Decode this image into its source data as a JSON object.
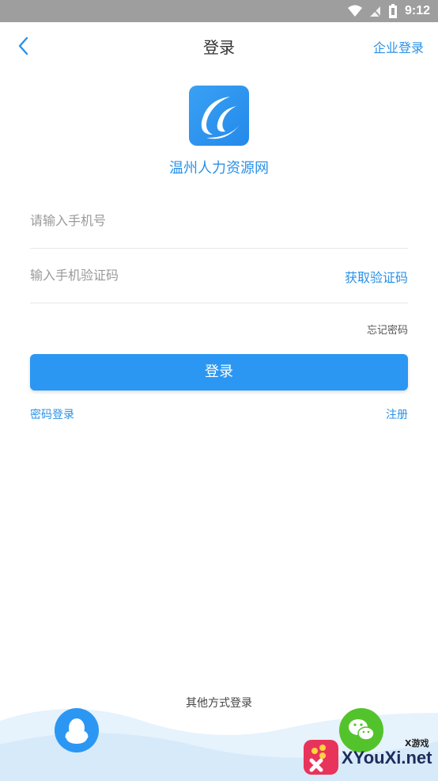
{
  "status_bar": {
    "time": "9:12"
  },
  "header": {
    "title": "登录",
    "enterprise_login": "企业登录"
  },
  "app": {
    "name": "温州人力资源网"
  },
  "form": {
    "phone_placeholder": "请输入手机号",
    "code_placeholder": "输入手机验证码",
    "get_code_label": "获取验证码",
    "forgot_password": "忘记密码",
    "login_button": "登录",
    "password_login": "密码登录",
    "register": "注册"
  },
  "other_login": {
    "label": "其他方式登录"
  },
  "colors": {
    "accent": "#2b91e8",
    "button": "#2b97f3",
    "wechat": "#53c32b"
  },
  "watermark": {
    "brand": "XYouXi.net",
    "small": "X游戏"
  }
}
